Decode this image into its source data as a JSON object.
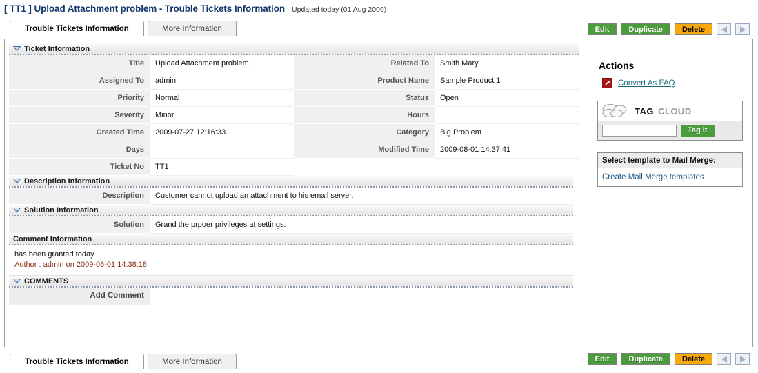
{
  "header": {
    "title": "[ TT1 ] Upload Attachment problem - Trouble Tickets Information",
    "updated": "Updated today (01 Aug 2009)"
  },
  "tabs": [
    {
      "label": "Trouble Tickets Information",
      "active": true
    },
    {
      "label": "More Information",
      "active": false
    }
  ],
  "actions_bar": {
    "edit": "Edit",
    "duplicate": "Duplicate",
    "delete": "Delete",
    "prev_icon": "arrow-left-icon",
    "next_icon": "arrow-right-icon"
  },
  "sections": {
    "ticket_information": {
      "title": "Ticket Information",
      "left": [
        {
          "label": "Title",
          "value": "Upload Attachment problem"
        },
        {
          "label": "Assigned To",
          "value": "admin"
        },
        {
          "label": "Priority",
          "value": "Normal"
        },
        {
          "label": "Severity",
          "value": "Minor"
        },
        {
          "label": "Created Time",
          "value": "2009-07-27 12:16:33"
        },
        {
          "label": "Days",
          "value": ""
        },
        {
          "label": "Ticket No",
          "value": "TT1"
        }
      ],
      "right": [
        {
          "label": "Related To",
          "value": "Smith Mary"
        },
        {
          "label": "Product Name",
          "value": "Sample Product 1"
        },
        {
          "label": "Status",
          "value": "Open"
        },
        {
          "label": "Hours",
          "value": ""
        },
        {
          "label": "Category",
          "value": "Big Problem"
        },
        {
          "label": "Modified Time",
          "value": "2009-08-01 14:37:41"
        },
        {
          "label": "",
          "value": ""
        }
      ]
    },
    "description_information": {
      "title": "Description Information",
      "label": "Description",
      "value": "Customer cannot upload an attachment to his email server."
    },
    "solution_information": {
      "title": "Solution Information",
      "label": "Solution",
      "value": "Grand the prpoer privileges at settings."
    },
    "comment_information": {
      "title": "Comment Information",
      "comment_text": "has been granted today",
      "comment_author": "Author : admin on 2009-08-01 14:38:18"
    },
    "comments": {
      "title": "COMMENTS",
      "add_comment": "Add Comment"
    }
  },
  "sidebar": {
    "actions_title": "Actions",
    "convert_faq": "Convert As FAQ",
    "convert_faq_icon": "external-link-icon",
    "tag_cloud": {
      "cloud_icon": "cloud-icon",
      "word_tag": "TAG",
      "word_cloud": "CLOUD",
      "input_value": "",
      "input_placeholder": "",
      "button": "Tag it"
    },
    "mail_merge": {
      "heading": "Select template to Mail Merge:",
      "link": "Create Mail Merge templates"
    }
  },
  "colors": {
    "title_blue": "#11366b",
    "green_button": "#4a9c3c",
    "orange_button": "#f8a90b",
    "faq_icon_red": "#a81717",
    "link_teal": "#1a6b7a",
    "author_red": "#8b2f14"
  }
}
